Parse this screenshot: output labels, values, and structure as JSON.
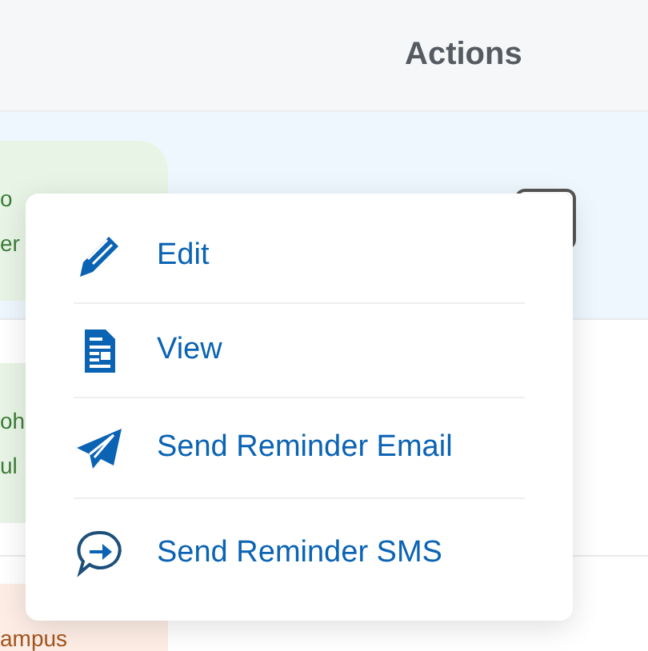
{
  "table": {
    "columns": [
      {
        "label": "Actions"
      }
    ],
    "rows": [
      {
        "tag": {
          "lines": [
            "o",
            "er"
          ],
          "kind": "green"
        },
        "highlighted": true
      },
      {
        "tag": {
          "lines": [
            "oh",
            "ul"
          ],
          "kind": "green"
        },
        "highlighted": false
      },
      {
        "tag": {
          "lines": [
            "ampus"
          ],
          "kind": "orange"
        },
        "highlighted": false
      }
    ]
  },
  "action_menu": {
    "items": [
      {
        "label": "Edit",
        "kind": "edit"
      },
      {
        "label": "View",
        "kind": "view"
      },
      {
        "label": "Send Reminder Email",
        "kind": "email"
      },
      {
        "label": "Send Reminder SMS",
        "kind": "sms"
      }
    ]
  }
}
